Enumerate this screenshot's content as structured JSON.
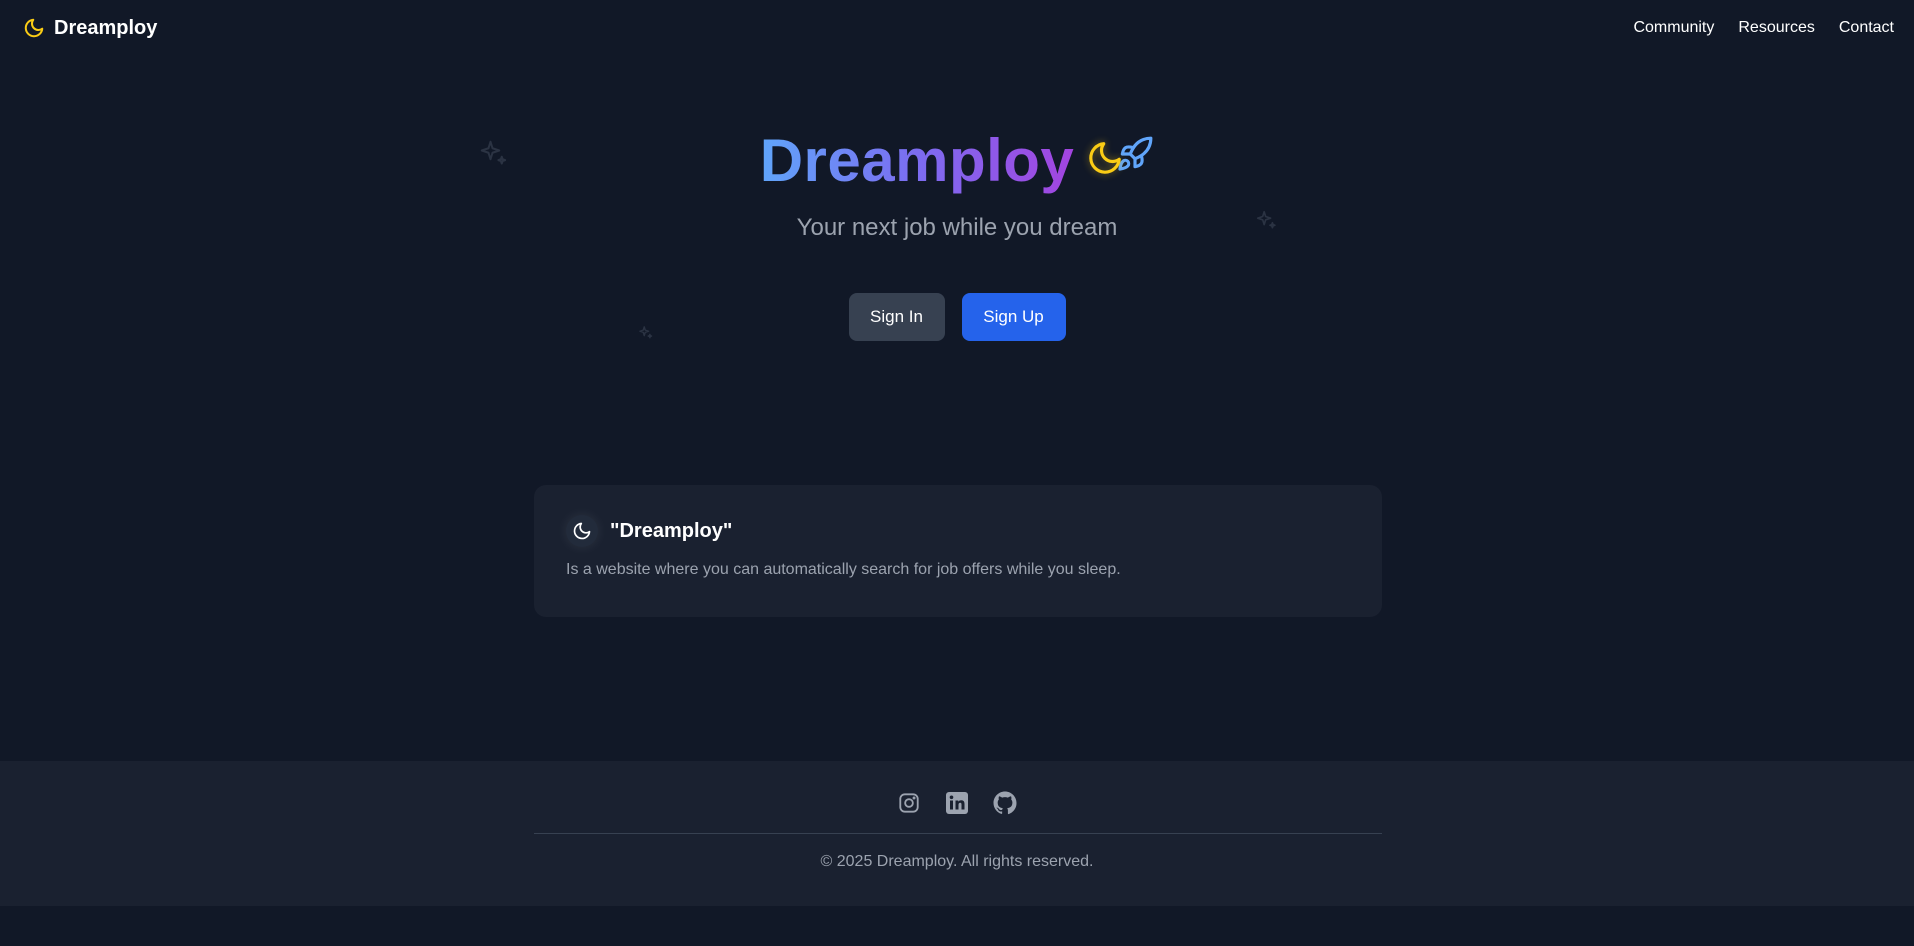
{
  "header": {
    "brand": "Dreamploy",
    "nav": [
      "Community",
      "Resources",
      "Contact"
    ]
  },
  "hero": {
    "title": "Dreamploy",
    "subtitle": "Your next job while you dream",
    "signin_label": "Sign In",
    "signup_label": "Sign Up"
  },
  "card": {
    "title": "\"Dreamploy\"",
    "text": "Is a website where you can automatically search for job offers while you sleep."
  },
  "footer": {
    "social_icons": [
      "instagram-icon",
      "linkedin-icon",
      "github-icon"
    ],
    "copyright": "© 2025 Dreamploy. All rights reserved."
  },
  "colors": {
    "background": "#111827",
    "surface": "#1a2130",
    "moon": "#facc15",
    "rocket": "#60a5fa",
    "primary": "#2563eb",
    "secondary": "#374151",
    "muted": "#9ca3af"
  }
}
